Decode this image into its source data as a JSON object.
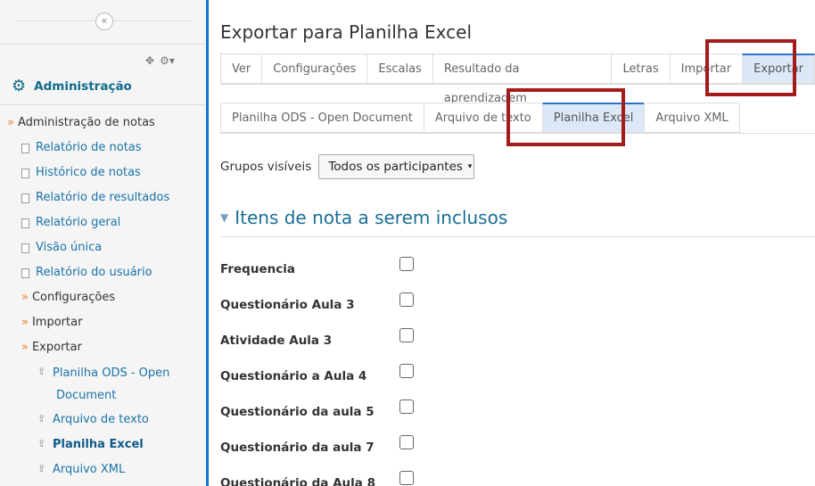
{
  "sidebar": {
    "collapse_icon": "«",
    "block_title": "Administração",
    "tree": [
      {
        "label": "Administração de notas",
        "kind": "parent",
        "state": "plain"
      },
      {
        "label": "Relatório de notas",
        "kind": "doc",
        "state": "link"
      },
      {
        "label": "Histórico de notas",
        "kind": "doc",
        "state": "link"
      },
      {
        "label": "Relatório de resultados",
        "kind": "doc",
        "state": "link"
      },
      {
        "label": "Relatório geral",
        "kind": "doc",
        "state": "link"
      },
      {
        "label": "Visão única",
        "kind": "doc",
        "state": "link"
      },
      {
        "label": "Relatório do usuário",
        "kind": "doc",
        "state": "link"
      },
      {
        "label": "Configurações",
        "kind": "parent",
        "state": "plain"
      },
      {
        "label": "Importar",
        "kind": "parent",
        "state": "plain"
      },
      {
        "label": "Exportar",
        "kind": "parent",
        "state": "plain"
      },
      {
        "label": "Planilha ODS - Open",
        "label_line2": "Document",
        "kind": "upload",
        "state": "link"
      },
      {
        "label": "Arquivo de texto",
        "kind": "upload",
        "state": "link"
      },
      {
        "label": "Planilha Excel",
        "kind": "upload",
        "state": "active"
      },
      {
        "label": "Arquivo XML",
        "kind": "upload",
        "state": "link"
      }
    ]
  },
  "main": {
    "title": "Exportar para Planilha Excel",
    "tabs": [
      {
        "label": "Ver"
      },
      {
        "label": "Configurações"
      },
      {
        "label": "Escalas"
      },
      {
        "label": "Resultado da aprendizagem"
      },
      {
        "label": "Letras"
      },
      {
        "label": "Importar"
      },
      {
        "label": "Exportar",
        "selected": true
      }
    ],
    "subtabs": [
      {
        "label": "Planilha ODS - Open Document"
      },
      {
        "label": "Arquivo de texto"
      },
      {
        "label": "Planilha Excel",
        "selected": true
      },
      {
        "label": "Arquivo XML"
      }
    ],
    "groups_label": "Grupos visíveis",
    "groups_value": "Todos os participantes",
    "section_title": "Itens de nota a serem inclusos",
    "grade_items": [
      {
        "name": "Frequencia",
        "checked": false
      },
      {
        "name": "Questionário Aula 3",
        "checked": false
      },
      {
        "name": "Atividade Aula 3",
        "checked": false
      },
      {
        "name": "Questionário a Aula 4",
        "checked": false
      },
      {
        "name": "Questionário da aula 5",
        "checked": false
      },
      {
        "name": "Questionário da aula 7",
        "checked": false
      },
      {
        "name": "Questionário da Aula 8",
        "checked": false
      }
    ]
  },
  "colors": {
    "accent": "#1177d1",
    "link": "#1a73a8",
    "highlight_border": "#a31b1b",
    "selected_tab_bg": "#dde8f7"
  }
}
